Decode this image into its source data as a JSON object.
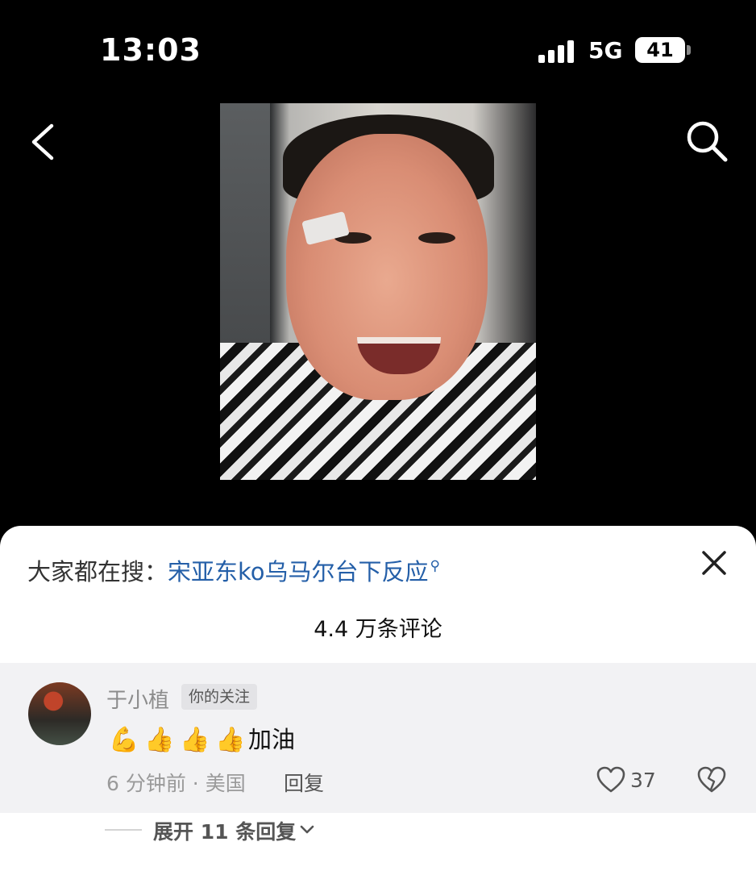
{
  "status_bar": {
    "time": "13:03",
    "network": "5G",
    "battery": "41"
  },
  "nav": {
    "back_icon": "chevron-left-icon",
    "search_icon": "search-icon"
  },
  "hot_search": {
    "prefix": "大家都在搜：",
    "query": "宋亚东ko乌马尔台下反应",
    "query_icon": "search-icon"
  },
  "comments_count": "4.4 万条评论",
  "comment": {
    "username": "于小植",
    "badge": "你的关注",
    "emojis": [
      "💪",
      "👍",
      "👍",
      "👍"
    ],
    "text": "加油",
    "time_location": "6 分钟前 · 美国",
    "reply_label": "回复",
    "likes": "37"
  },
  "expand_replies": "展开 11 条回复",
  "colors": {
    "link": "#245fa8",
    "sheet_bg": "#ffffff",
    "comment_bg": "#f2f2f4"
  }
}
